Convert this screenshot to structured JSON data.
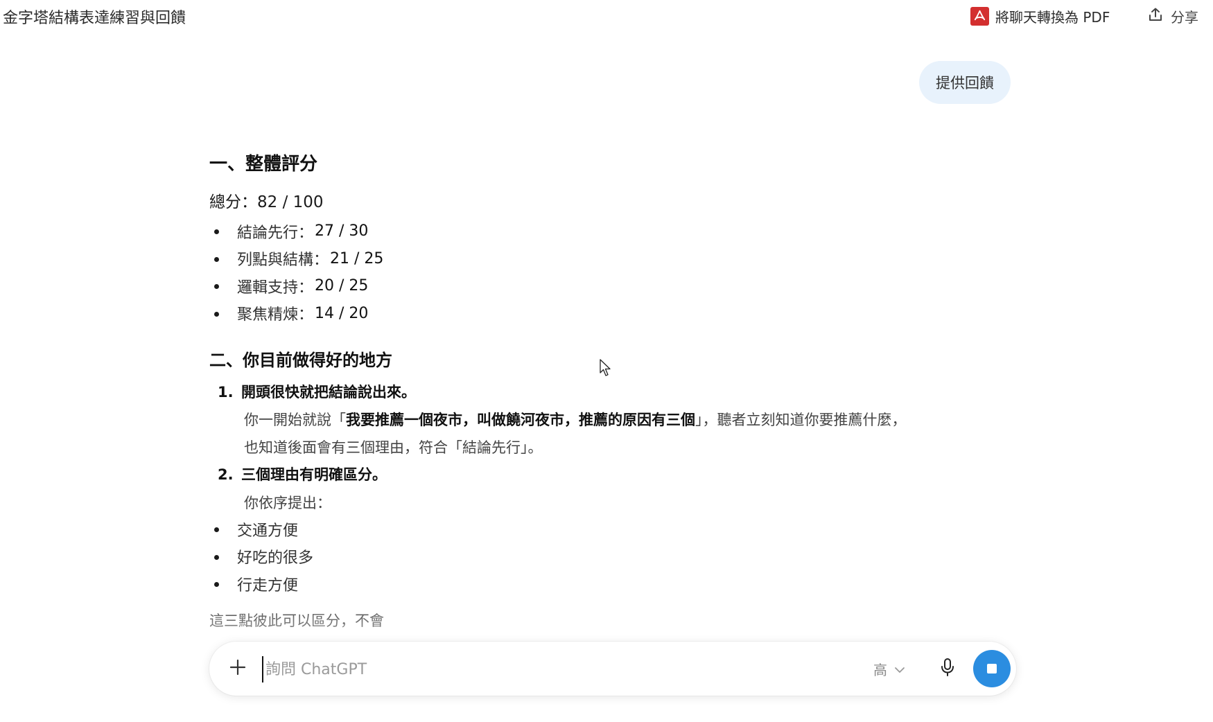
{
  "header": {
    "title": "金字塔結構表達練習與回饋",
    "pdf_label": "將聊天轉換為 PDF",
    "share_label": "分享"
  },
  "user_message": "提供回饋",
  "response": {
    "section1_heading": "一、整體評分",
    "total_label": "總分：",
    "total_value": "82 / 100",
    "scores": [
      {
        "label": "結論先行：",
        "value": "27 / 30"
      },
      {
        "label": "列點與結構：",
        "value": "21 / 25"
      },
      {
        "label": "邏輯支持：",
        "value": "20 / 25"
      },
      {
        "label": "聚焦精煉：",
        "value": "14 / 20"
      }
    ],
    "section2_heading": "二、你目前做得好的地方",
    "item1": {
      "number": "1.",
      "title": "開頭很快就把結論說出來。",
      "line1_prefix": "你一開始就說「",
      "line1_bold": "我要推薦一個夜市，叫做饒河夜市，推薦的原因有三個",
      "line1_suffix": "」，聽者立刻知道你要推薦什麼，",
      "line2": "也知道後面會有三個理由，符合「結論先行」。"
    },
    "item2": {
      "number": "2.",
      "title": "三個理由有明確區分。",
      "intro": "你依序提出："
    },
    "reasons": [
      "交通方便",
      "好吃的很多",
      "行走方便"
    ],
    "partial_line": "這三點彼此可以區分，不會"
  },
  "composer": {
    "placeholder": "詢問 ChatGPT",
    "effort_label": "高"
  },
  "colors": {
    "accent": "#2b8de0",
    "bubble": "#e8f2fc",
    "pdf_icon": "#d32f2f"
  },
  "icons": [
    "pdf-icon",
    "share-icon",
    "plus-icon",
    "chevron-down-icon",
    "microphone-icon",
    "stop-icon",
    "mouse-cursor-icon"
  ]
}
